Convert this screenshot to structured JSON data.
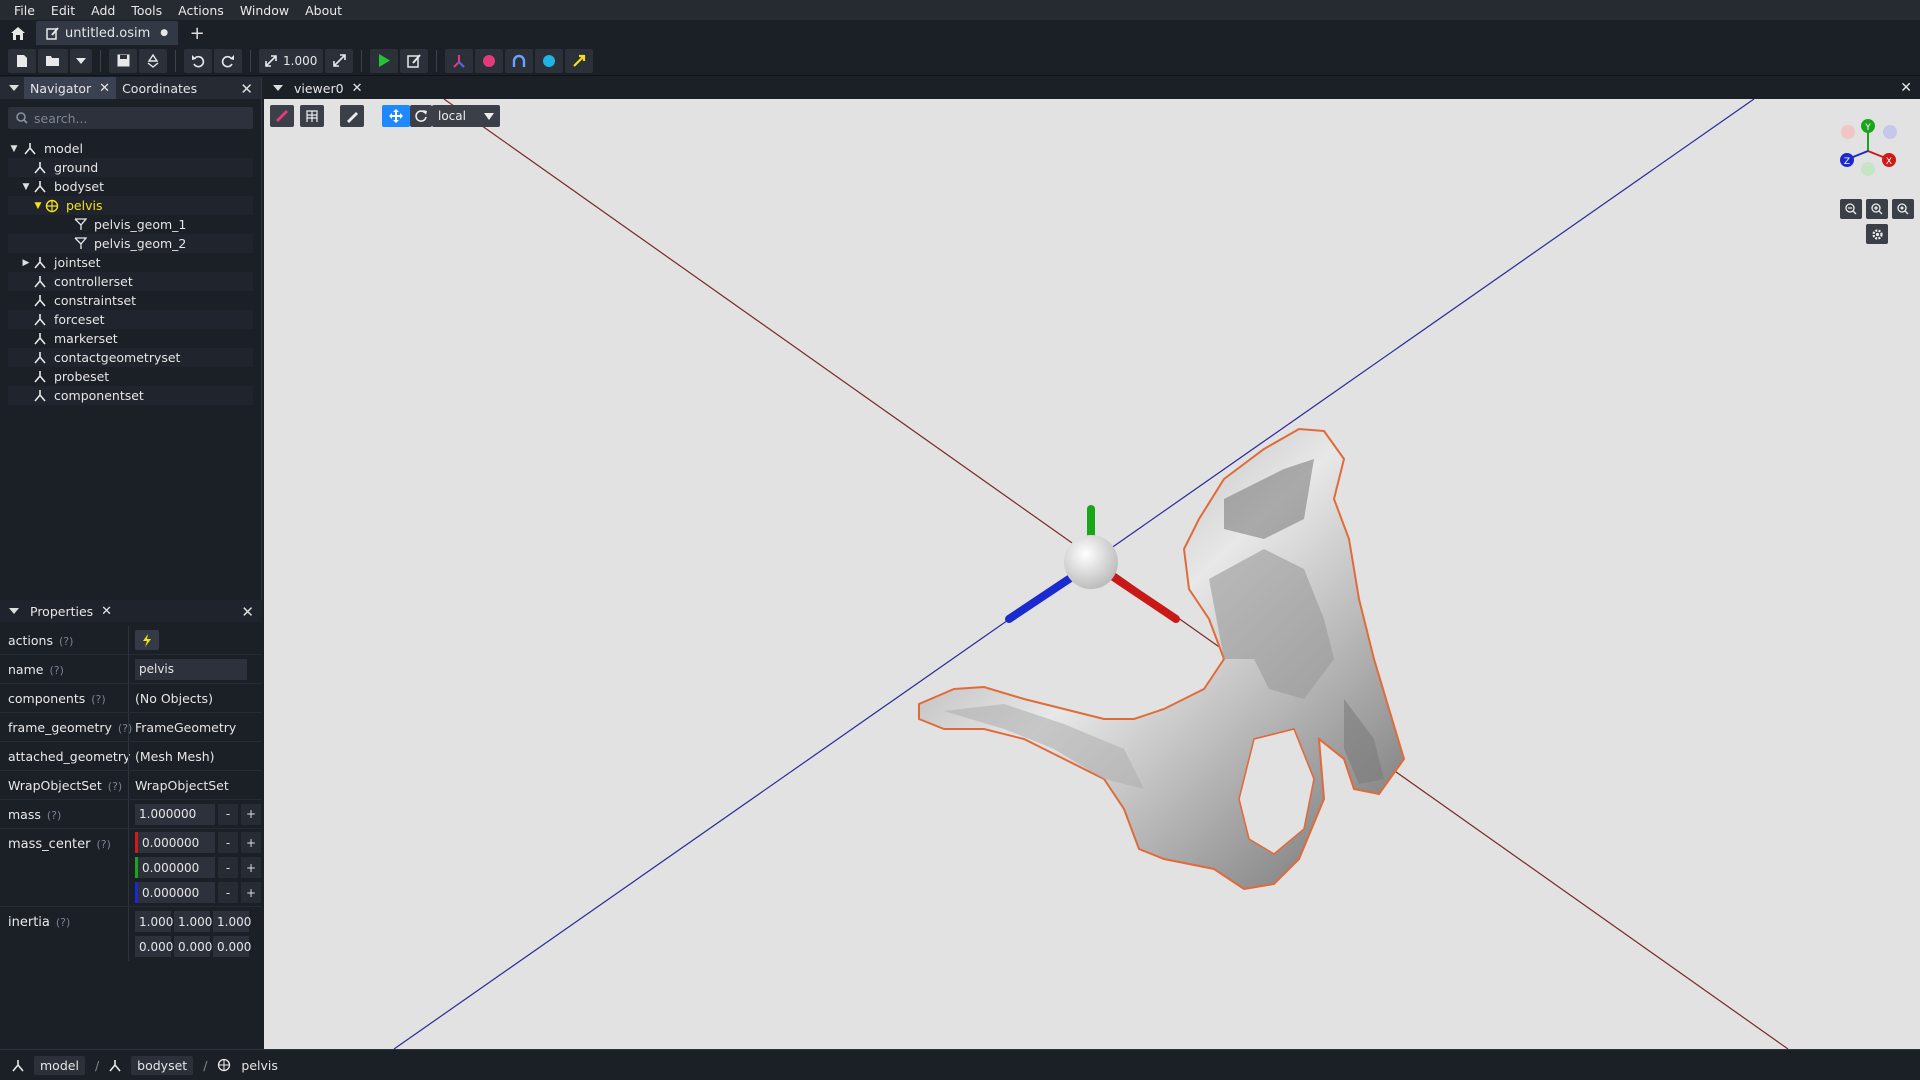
{
  "menu": [
    "File",
    "Edit",
    "Add",
    "Tools",
    "Actions",
    "Window",
    "About"
  ],
  "tabs": {
    "doc_label": "untitled.osim",
    "modified_dot": "●",
    "add": "+"
  },
  "toolbar": {
    "scale_value": "1.000"
  },
  "navigator": {
    "tab_label": "Navigator",
    "coords_label": "Coordinates",
    "search_placeholder": "search...",
    "items": [
      {
        "label": "model"
      },
      {
        "label": "ground"
      },
      {
        "label": "bodyset"
      },
      {
        "label": "pelvis"
      },
      {
        "label": "pelvis_geom_1"
      },
      {
        "label": "pelvis_geom_2"
      },
      {
        "label": "jointset"
      },
      {
        "label": "controllerset"
      },
      {
        "label": "constraintset"
      },
      {
        "label": "forceset"
      },
      {
        "label": "markerset"
      },
      {
        "label": "contactgeometryset"
      },
      {
        "label": "probeset"
      },
      {
        "label": "componentset"
      }
    ]
  },
  "properties": {
    "title": "Properties",
    "q": "(?)",
    "rows": {
      "actions": "actions",
      "name": "name",
      "name_value": "pelvis",
      "components": "components",
      "components_value": "(No Objects)",
      "frame_geometry": "frame_geometry",
      "frame_geometry_value": "FrameGeometry",
      "attached_geometry": "attached_geometry",
      "attached_geometry_value": "(Mesh Mesh)",
      "wrap": "WrapObjectSet",
      "wrap_value": "WrapObjectSet",
      "mass": "mass",
      "mass_value": "1.000000",
      "mass_center": "mass_center",
      "mc_x": "0.000000",
      "mc_y": "0.000000",
      "mc_z": "0.000000",
      "inertia": "inertia",
      "inertia_row1": [
        "1.000",
        "1.000",
        "1.000"
      ],
      "inertia_row2": [
        "0.000",
        "0.000",
        "0.000"
      ]
    },
    "minus": "-",
    "plus": "+"
  },
  "viewer": {
    "tab_label": "viewer0",
    "frame_mode": "local",
    "axes": {
      "y": "Y",
      "x": "X",
      "z": "Z"
    }
  },
  "statusbar": {
    "crumbs": [
      "model",
      "bodyset",
      "pelvis"
    ],
    "sep": "/"
  },
  "colors": {
    "accent": "#1e88ff",
    "selection": "#f5e11a",
    "x_axis": "#d01a1a",
    "y_axis": "#1aa51a",
    "z_axis": "#1a2ad0",
    "mesh_outline": "#e06b3a"
  }
}
